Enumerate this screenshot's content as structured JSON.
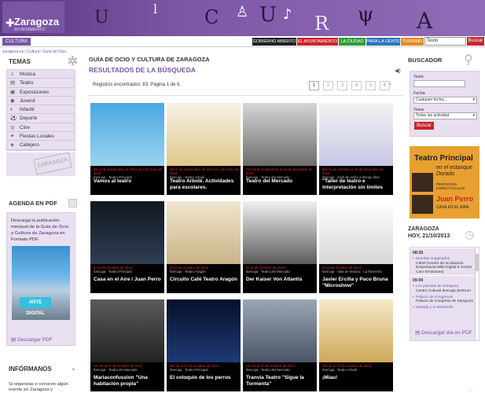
{
  "header": {
    "logo_text": "Zaragoza",
    "logo_sub": "AYUNTAMIENTO",
    "deco": [
      "U",
      "l",
      "C",
      "U",
      "R",
      "A"
    ]
  },
  "topbar": {
    "section_tab": "CULTURA",
    "nav": [
      {
        "label": "GOBIERNO ABIERTO",
        "color": "#222222"
      },
      {
        "label": "EL AYUNTAMIENTO",
        "color": "#c9252c"
      },
      {
        "label": "LA CIUDAD",
        "color": "#2e9b3a"
      },
      {
        "label": "PARA LA GENTE",
        "color": "#2a76b8"
      },
      {
        "label": "TURISMO",
        "color": "#e58a1f"
      }
    ],
    "search_value": "Texto",
    "search_button": "Buscar"
  },
  "breadcrumb": "zaragoza.es / Cultura / Guía de Ocio",
  "sidebar": {
    "temas_title": "TEMAS",
    "items": [
      {
        "label": "Música",
        "icon": "music-icon",
        "glyph": "♫"
      },
      {
        "label": "Teatro",
        "icon": "theater-icon",
        "glyph": "▤"
      },
      {
        "label": "Exposiciones",
        "icon": "exhibition-icon",
        "glyph": "▣"
      },
      {
        "label": "Juvenil",
        "icon": "youth-icon",
        "glyph": "◉"
      },
      {
        "label": "Infantil",
        "icon": "kids-icon",
        "glyph": "◐"
      },
      {
        "label": "Deporte",
        "icon": "sport-icon",
        "glyph": "⚽"
      },
      {
        "label": "Cine",
        "icon": "cinema-icon",
        "glyph": "◎"
      },
      {
        "label": "Fiestas Locales",
        "icon": "party-icon",
        "glyph": "✦"
      },
      {
        "label": "Callejero",
        "icon": "map-pin-icon",
        "glyph": "◈"
      }
    ],
    "seal_text": "ZARAGOZA",
    "agenda_title": "AGENDA EN PDF",
    "agenda_text_1": "Descarga la publicación mensual de la ",
    "agenda_text_bold": "Guía de Ocio y Cultura de Zaragoza",
    "agenda_text_2": " en Formato PDF.",
    "agenda_photo_label": "ARTE DIGITAL",
    "download_pdf": "Descargar PDF",
    "informanos_title": "INFÓRMANOS",
    "informanos_text": "Si organizas o conoces algún evento en Zaragoza y"
  },
  "main": {
    "title": "GUÍA DE OCIO Y CULTURA DE ZARAGOZA",
    "subtitle": "RESULTADOS DE LA BÚSQUEDA",
    "records": "Registros encontrados: 83. Página 1 de 6.",
    "pages": [
      "1",
      "2",
      "3",
      "4",
      "5",
      "6"
    ],
    "next": "&raquo;",
    "cards": [
      {
        "date": "Del 1 de Septiembre de 2013 al 1 de Junio de 2014",
        "venue": "Ibercaja · Teatro Principal",
        "title": "Vamos al teatro",
        "bg": "linear-gradient(180deg,#4aa7e0,#9bd3ef)"
      },
      {
        "date": "Del 1 de Septiembre de 2013 al 1 de Junio de 2014",
        "venue": "Ibercaja · Teatro Arbolé",
        "title": "Teatro Arbolé. Actividades para escolares.",
        "bg": "linear-gradient(180deg,#f7f2e6,#e0c88c)"
      },
      {
        "date": "Del 19 de Septiembre al 19 de Diciembre de 2013",
        "venue": "Ibercaja · Teatro del Mercado",
        "title": "Teatro del Mercado",
        "bg": "linear-gradient(180deg,#d6d6d6,#6d6d6d)"
      },
      {
        "date": "Del 16 de Octubre al 16 de Diciembre de 2013",
        "venue": "Ibercaja · Club de otoño a tiempo libre",
        "title": "\"Taller de teatro e interpretación sin límites",
        "bg": "linear-gradient(180deg,#f3f3f3,#c7c7e6)"
      },
      {
        "date": "El 23 de Octubre de 2013",
        "venue": "Ibercaja · Teatro Principal",
        "title": "Casa en el Aire / Juan Perro",
        "bg": "linear-gradient(180deg,#101820,#2f3e52)"
      },
      {
        "date": "El 23 de Octubre de 2013",
        "venue": "Ibercaja · Teatro Aragón",
        "title": "Circuito Café Teatro Aragón",
        "bg": "linear-gradient(180deg,#efe6cf,#c9b387)"
      },
      {
        "date": "El 26 de Octubre de 2013",
        "venue": "Ibercaja · Teatro del Mercado",
        "title": "Der Kaiser Von Atlantis",
        "bg": "linear-gradient(180deg,#f0f0f0,#5b5b5b)"
      },
      {
        "date": "El 26 de Octubre de 2013",
        "venue": "Ibercaja · Sala de Música · La Ribereña",
        "title": "Javier Ercilla y Paco Bruna \"Microshow\"",
        "bg": "linear-gradient(180deg,#ffffff,#d6d6d6)"
      },
      {
        "date": "Del 26 al 27 de Octubre de 2013",
        "venue": "Ibercaja · Teatro del Mercado",
        "title": "Mariaconfussion \"Una habitación propia\"",
        "bg": "linear-gradient(180deg,#5a5a5a,#222222)"
      },
      {
        "date": "Del 26 al 27 de Octubre de 2013",
        "venue": "Ibercaja · Teatro Principal",
        "title": "El coloquio de los perros",
        "bg": "linear-gradient(180deg,#06102a,#1f3a73)"
      },
      {
        "date": "Del 26 al 27 de Octubre de 2013",
        "venue": "Ibercaja · Teatro del Mercado",
        "title": "Tranvía Teatro \"Sigue la Tormenta\"",
        "bg": "linear-gradient(180deg,#9aa6b6,#4b5466)"
      },
      {
        "date": "Del 26 al 27 de Octubre de 2013",
        "venue": "Ibercaja · Teatro Arbolé",
        "title": "¡Miau!",
        "bg": "linear-gradient(180deg,#f5e9c8,#cfa85a)"
      }
    ]
  },
  "right": {
    "buscador_title": "BUSCADOR",
    "texto_label": "Texto",
    "fecha_label": "Fecha",
    "fecha_value": "Cualquier fecha...",
    "tema_label": "Tema",
    "tema_value": "Todas las actividad",
    "buscar": "Buscar",
    "banner_title": "Teatro Principal",
    "banner_sub": "en el estanque Dorado",
    "banner_sub2": "PENTACIÓN ESPECTÁCULOS",
    "banner_artist": "Juan Perro",
    "banner_artist_sub": "CASA EN EL AIRE",
    "zaragoza_hoy_1": "ZARAGOZA",
    "zaragoza_hoy_2": "HOY, 21/10/2013",
    "agenda": [
      {
        "time": "08:30",
        "items": [
          {
            "name": "Mundos Imaginados",
            "venue": "CIEM (Centro de Incubación Empresarial Milla Digital II Centro Caro Emisiones)"
          }
        ]
      },
      {
        "time": "09:00",
        "items": [
          {
            "name": "Los puentes de Zaragoza",
            "venue": "Centro Cultural Ibercaja Zentrum"
          },
          {
            "name": "Palacio de Congresos",
            "venue": "Palacio de Congreso de Zaragoza"
          },
          {
            "name": "Wassily y el desarrollo",
            "venue": ""
          }
        ]
      }
    ],
    "download_pdf": "Descargar día en PDF"
  }
}
